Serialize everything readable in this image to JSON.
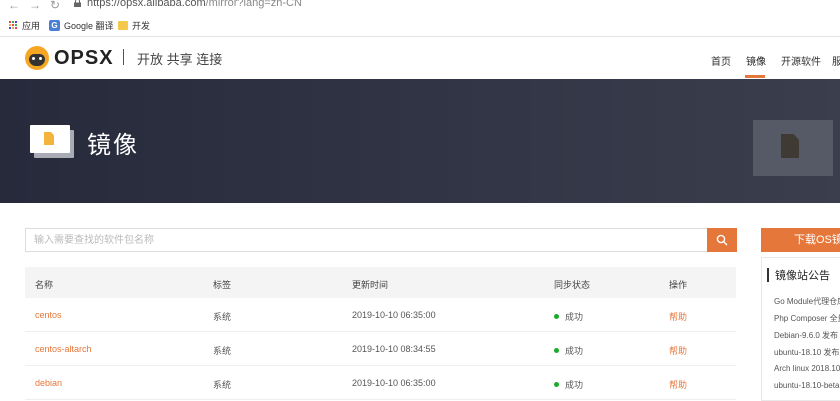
{
  "browser": {
    "url_host": "https://opsx.alibaba.com",
    "url_path": "/mirror?lang=zh-CN",
    "bookmarks": [
      {
        "label": "应用",
        "icon": "apps-icon"
      },
      {
        "label": "Google 翻译",
        "icon": "google-translate-icon"
      },
      {
        "label": "开发",
        "icon": "folder-icon"
      }
    ]
  },
  "header": {
    "brand": "OPSX",
    "slogan": "开放 共享 连接",
    "nav": [
      "首页",
      "镜像",
      "开源软件",
      "服"
    ],
    "active_nav": "镜像"
  },
  "banner": {
    "title": "镜像"
  },
  "search": {
    "placeholder": "输入需要查找的软件包名称"
  },
  "table": {
    "columns": [
      "名称",
      "标签",
      "更新时间",
      "同步状态",
      "操作"
    ],
    "rows": [
      {
        "name": "centos",
        "tag": "系统",
        "updated": "2019-10-10 06:35:00",
        "status": "成功",
        "action": "帮助"
      },
      {
        "name": "centos-altarch",
        "tag": "系统",
        "updated": "2019-10-10 08:34:55",
        "status": "成功",
        "action": "帮助"
      },
      {
        "name": "debian",
        "tag": "系统",
        "updated": "2019-10-10 06:35:00",
        "status": "成功",
        "action": "帮助"
      }
    ]
  },
  "sidebar": {
    "download_label": "下载OS镜",
    "notice_title": "镜像站公告",
    "notices": [
      "Go Module代理仓库",
      "Php Composer 全量",
      "Debian-9.6.0 发布",
      "ubuntu-18.10 发布",
      "Arch linux 2018.10",
      "ubuntu-18.10-beta"
    ]
  },
  "colors": {
    "accent": "#e5773b",
    "banner": "#2b2f3f",
    "success": "#1aab2a"
  }
}
